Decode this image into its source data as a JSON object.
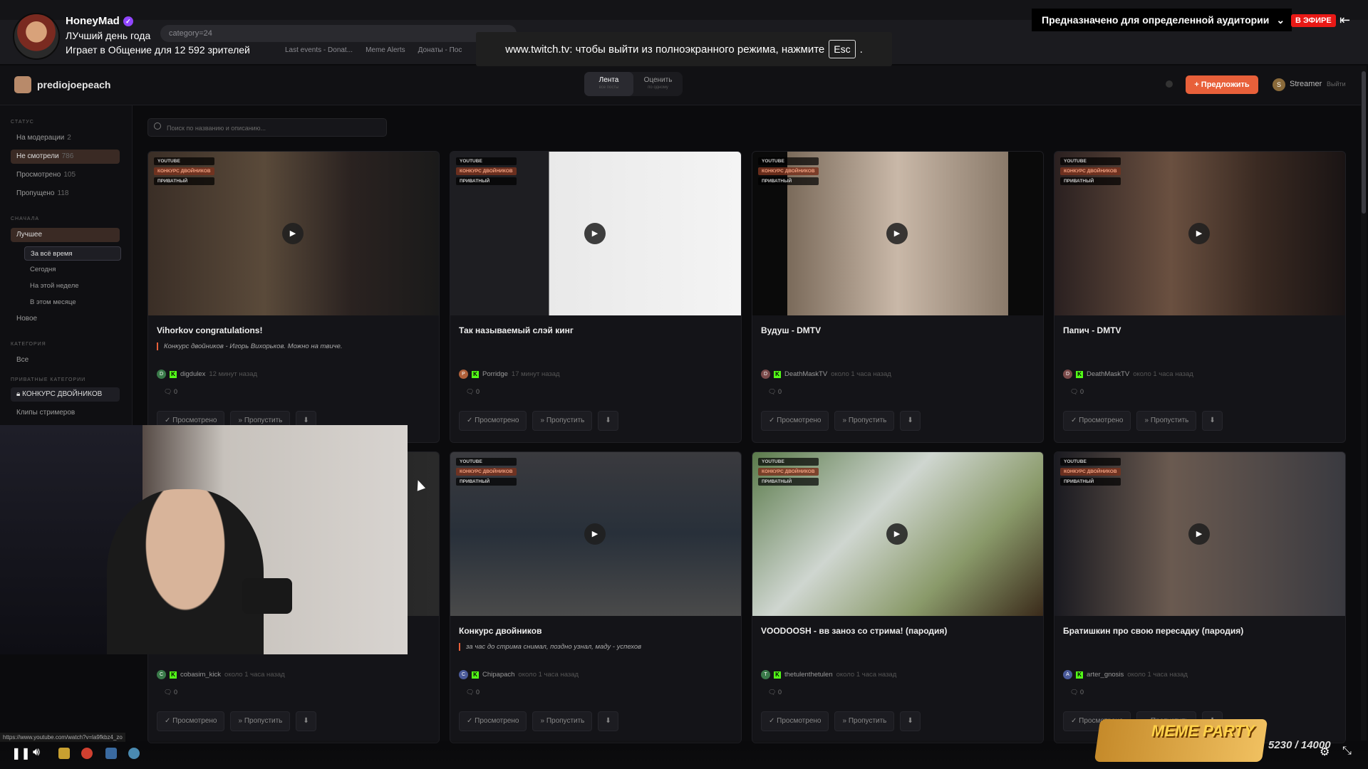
{
  "browser": {
    "address_fragment": "category=24",
    "bookmarks": [
      "Last events - Donat...",
      "Meme Alerts",
      "Донаты - Пос"
    ]
  },
  "twitch": {
    "streamer": "HoneyMad",
    "stream_title": "ЛУчший день года",
    "game_line": "Играет в Общение для 12 592 зрителей",
    "audience_banner": "Предназначено для определенной аудитории",
    "live_badge": "В ЭФИРЕ",
    "fullscreen_notice": "www.twitch.tv: чтобы выйти из полноэкранного режима, нажмите",
    "fullscreen_key": "Esc",
    "fullscreen_suffix": "."
  },
  "app": {
    "name": "prediojoepeach",
    "tabs": [
      {
        "label": "Лента",
        "sub": "все посты",
        "active": true
      },
      {
        "label": "Оценить",
        "sub": "по одному",
        "active": false
      }
    ],
    "suggest_button": "+ Предложить",
    "user_initial": "S",
    "user_name": "Streamer",
    "logout": "Выйти",
    "search_placeholder": "Поиск по названию и описанию...",
    "colors": {
      "accent": "#e8603a",
      "kick_green": "#53fc18",
      "live_red": "#e91916"
    }
  },
  "sidebar": {
    "status_head": "СТАТУС",
    "status_items": [
      {
        "label": "На модерации",
        "count": "2"
      },
      {
        "label": "Не смотрели",
        "count": "786"
      },
      {
        "label": "Просмотрено",
        "count": "105"
      },
      {
        "label": "Пропущено",
        "count": "118"
      }
    ],
    "sort_head": "СНАЧАЛА",
    "sort_best": "Лучшее",
    "sort_periods": [
      "За всё время",
      "Сегодня",
      "На этой неделе",
      "В этом месяце"
    ],
    "sort_new": "Новое",
    "category_head": "КАТЕГОРИЯ",
    "category_all": "Все",
    "private_head": "ПРИВАТНЫЕ КАТЕГОРИИ",
    "private_contest": "КОНКУРС ДВОЙНИКОВ",
    "streamer_clips": "Клипы стримеров"
  },
  "card_common": {
    "tag_youtube": "YOUTUBE",
    "tag_contest": "КОНКУРС ДВОЙНИКОВ",
    "tag_private": "ПРИВАТНЫЙ",
    "btn_watched": "✓ Просмотрено",
    "btn_skip": "» Пропустить",
    "btn_pin": "⬇"
  },
  "cards": [
    {
      "title": "Vihorkov congratulations!",
      "desc": "Конкурс двойников - Игорь Вихорьков. Можно на твиче.",
      "initial": "D",
      "author": "digdulex",
      "time": "12 минут назад",
      "comments": "0"
    },
    {
      "title": "Так называемый слэй кинг",
      "desc": "",
      "initial": "P",
      "author": "Porridge",
      "time": "17 минут назад",
      "comments": "0"
    },
    {
      "title": "Вудуш - DMTV",
      "desc": "",
      "initial": "D",
      "author": "DeathMaskTV",
      "time": "около 1 часа назад",
      "comments": "0"
    },
    {
      "title": "Папич - DMTV",
      "desc": "",
      "initial": "D",
      "author": "DeathMaskTV",
      "time": "около 1 часа назад",
      "comments": "0"
    },
    {
      "title": "",
      "desc": "",
      "initial": "C",
      "author": "cobasim_kick",
      "time": "около 1 часа назад",
      "comments": "0"
    },
    {
      "title": "Конкурс двойников",
      "desc": "за час до стрима снимал, поздно узнал, маду - успехов",
      "initial": "C",
      "author": "Chipapach",
      "time": "около 1 часа назад",
      "comments": "0"
    },
    {
      "title": "VOODOOSH - вв заноз со стрима! (пародия)",
      "desc": "",
      "initial": "T",
      "author": "thetulenthetulen",
      "time": "около 1 часа назад",
      "comments": "0"
    },
    {
      "title": "Братишкин про свою пересадку (пародия)",
      "desc": "",
      "initial": "A",
      "author": "arter_gnosis",
      "time": "около 1 часа назад",
      "comments": "0"
    }
  ],
  "status_url": "https://www.youtube.com/watch?v=la9fkbz4_zo",
  "meme_party": {
    "label": "MEME PARTY",
    "counter": "5230 / 14000"
  }
}
